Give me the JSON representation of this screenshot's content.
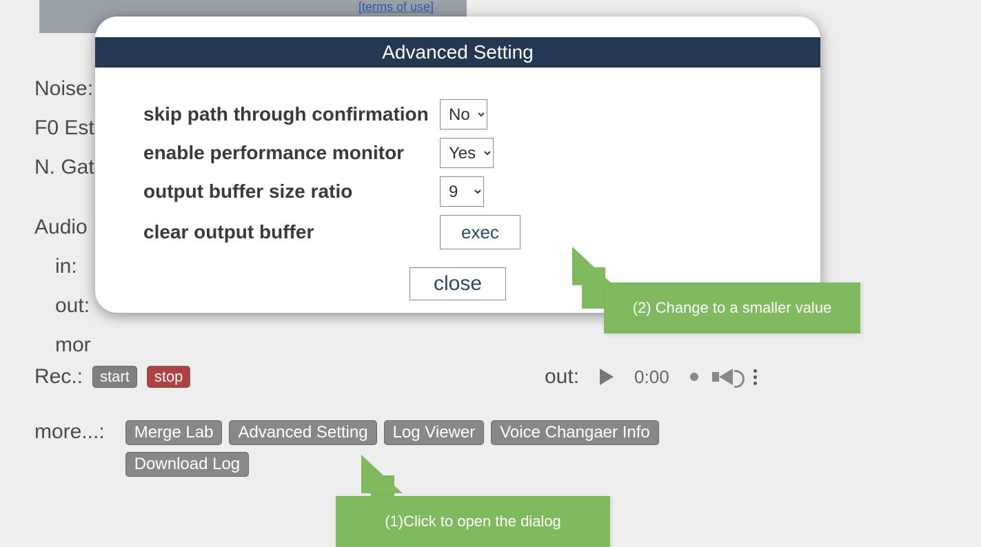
{
  "terms_link": "[terms of use]",
  "bg": {
    "noise": "Noise:",
    "f0": "F0 Est",
    "ngat": "N. Gat",
    "audio": "Audio",
    "in": "in:",
    "out": "out:",
    "mon": "mor",
    "rec": "Rec.:",
    "start": "start",
    "stop": "stop",
    "out2": "out:",
    "time": "0:00",
    "more_label": "more...:"
  },
  "more_buttons": {
    "merge": "Merge Lab",
    "advanced": "Advanced Setting",
    "log": "Log Viewer",
    "info": "Voice Changaer Info",
    "download": "Download Log"
  },
  "dialog": {
    "title": "Advanced Setting",
    "skip_label": "skip path through confirmation",
    "skip_value": "No",
    "perf_label": "enable performance monitor",
    "perf_value": "Yes",
    "buffer_label": "output buffer size ratio",
    "buffer_value": "9",
    "clear_label": "clear output buffer",
    "exec": "exec",
    "close": "close"
  },
  "callouts": {
    "c1": "(1)Click to open the dialog",
    "c2": "(2) Change to a smaller value"
  }
}
